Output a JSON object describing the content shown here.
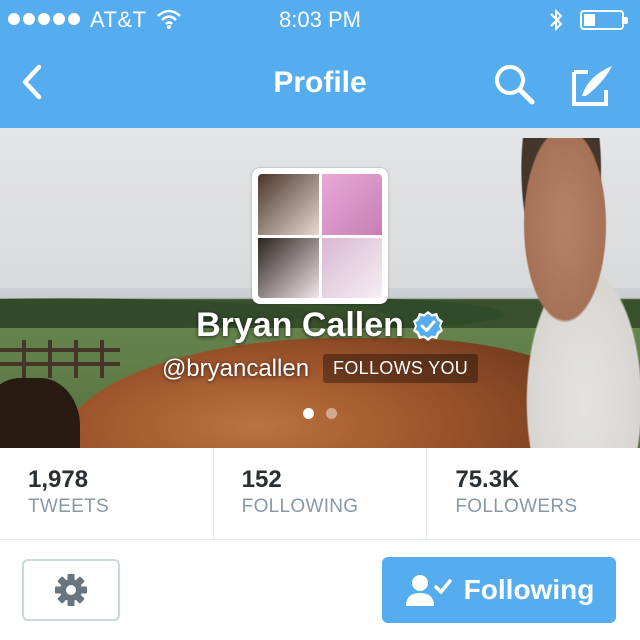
{
  "status_bar": {
    "carrier": "AT&T",
    "time": "8:03 PM",
    "signal_icon": "signal-dots-icon",
    "wifi_icon": "wifi-icon",
    "bluetooth_icon": "bluetooth-icon",
    "battery_icon": "battery-icon",
    "battery_level": 0.3
  },
  "nav": {
    "title": "Profile",
    "back_icon": "chevron-left-icon",
    "search_icon": "search-icon",
    "compose_icon": "compose-icon"
  },
  "profile": {
    "name": "Bryan Callen",
    "handle": "@bryancallen",
    "follows_you": "FOLLOWS YOU",
    "verified_icon": "verified-badge-icon",
    "header_page": 1,
    "header_pages": 2
  },
  "stats": [
    {
      "value": "1,978",
      "label": "TWEETS"
    },
    {
      "value": "152",
      "label": "FOLLOWING"
    },
    {
      "value": "75.3K",
      "label": "FOLLOWERS"
    }
  ],
  "actions": {
    "settings_icon": "gear-icon",
    "follow_label": "Following",
    "follow_icon": "person-check-icon"
  },
  "colors": {
    "brand": "#55acee",
    "text": "#292f33",
    "muted": "#8899a6"
  }
}
